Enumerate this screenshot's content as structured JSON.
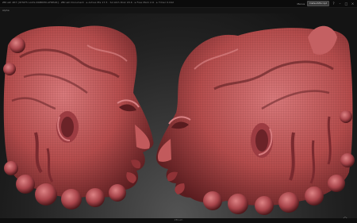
{
  "titlebar": {
    "app_text": "ZBrush 4R7 [IOTAT5 LAUS-NOBRED-AFREAR] · ZBrush Document · ▸ Active Pts 17.5 · Scratch Disk 18.6 · ▸ Free Mem 2.6 · ▸ Timer 0.042",
    "mode_label": "Menus",
    "script_label": "DefaultZScript",
    "buttons": [
      "?",
      "–",
      "□",
      "×"
    ]
  },
  "menu": {
    "first_item": "Alpha"
  },
  "footer": {
    "status": "ZBrush"
  },
  "icons": {
    "perspective": "perspective-icon"
  },
  "colors": {
    "clay": "#b44c4c",
    "clay_dark": "#5a1c1f",
    "clay_light": "#d9797b"
  }
}
